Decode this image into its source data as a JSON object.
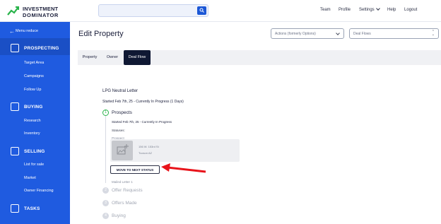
{
  "brand": {
    "line1": "INVESTMENT",
    "line2": "DOMINATOR"
  },
  "search": {
    "placeholder": ""
  },
  "topnav": {
    "team": "Team",
    "profile": "Profile",
    "settings": "Settings",
    "help": "Help",
    "logout": "Logout"
  },
  "sidebar": {
    "reduce": "Menu reduce",
    "sections": [
      {
        "label": "PROSPECTING",
        "icon": "target-icon",
        "items": [
          "Target Area",
          "Campaigns",
          "Follow Up"
        ]
      },
      {
        "label": "BUYING",
        "icon": "document-icon",
        "items": [
          "Research",
          "Inventory"
        ]
      },
      {
        "label": "SELLING",
        "icon": "dollar-icon",
        "items": [
          "List for sale",
          "Market",
          "Owner Financing"
        ]
      },
      {
        "label": "TASKS",
        "icon": "check-icon",
        "items": []
      }
    ]
  },
  "page": {
    "title": "Edit Property",
    "actions_select": "Actions (formerly Options)",
    "deal_flows_select": "Deal Flows"
  },
  "tabs": [
    "Property",
    "Owner",
    "Deal Flow"
  ],
  "deal_flow": {
    "name": "LPG Neutral Letter",
    "started": "Started Feb 7th, 25 - Currently In Progress (1 Days)",
    "steps": [
      {
        "num": "1",
        "label": "Prospects",
        "active": true
      },
      {
        "num": "2",
        "label": "Offer Requests",
        "active": false
      },
      {
        "num": "3",
        "label": "Offers Made",
        "active": false
      },
      {
        "num": "4",
        "label": "Buying",
        "active": false
      }
    ],
    "prospects": {
      "started": "Started Feb 7th, 25 - Currently In Progress",
      "statuses_label": "Statuses:",
      "prospect_label": "Prospect",
      "address_line1": "156 W. 153rd St",
      "address_line2": "Tucson AZ",
      "move_button": "MOVE TO NEXT STATUS",
      "next_status": "Mailed Letter 1"
    }
  },
  "colors": {
    "sidebar": "#1f5be0",
    "accent": "#1b57d6",
    "active_tab": "#0f1833",
    "step_on": "#29b34a",
    "arrow": "#e8131a"
  }
}
